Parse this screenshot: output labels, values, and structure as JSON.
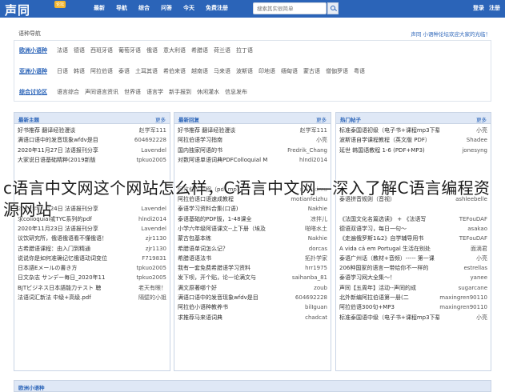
{
  "header": {
    "logo": "声同",
    "logo_badge": "论坛",
    "nav": [
      "最新",
      "导航",
      "综合",
      "问答",
      "今天",
      "免费注册"
    ],
    "search_placeholder": "搜索其实很简单",
    "login": "登录",
    "register": "注册"
  },
  "breadcrumb": "语种导航",
  "welcome": "声同 小语种论坛欢迎大家的光临！",
  "categories": [
    {
      "head": "欧洲小语种",
      "items": [
        "法语",
        "德语",
        "西班牙语",
        "葡萄牙语",
        "俄语",
        "意大利语",
        "希腊语",
        "荷兰语",
        "拉丁语"
      ]
    },
    {
      "head": "亚洲小语种",
      "items": [
        "日语",
        "韩语",
        "阿拉伯语",
        "泰语",
        "土耳其语",
        "希伯来语",
        "越南语",
        "马来语",
        "波斯语",
        "印地语",
        "缅甸语",
        "蒙古语",
        "僧伽罗语",
        "粤语"
      ]
    },
    {
      "head": "综合讨论区",
      "items": [
        "语言综合",
        "声同语言资讯",
        "世界语",
        "语言学",
        "新手报到",
        "休闲灌水",
        "信息发布"
      ]
    }
  ],
  "panels": [
    {
      "title": "最新主题",
      "more": "更多",
      "rows": [
        {
          "title": "好书推荐 翻译经验漫谈",
          "user": "赵学军111"
        },
        {
          "title": "满语口语中的发音现象wfdv是目",
          "user": "604692228"
        },
        {
          "title": "2020年11月27日 法语报刊分享",
          "user": "Lavendel"
        },
        {
          "title": "大家说日语基础精粹(2019新版",
          "user": "tpkuo2005"
        },
        {
          "title": "",
          "user": ""
        },
        {
          "title": "",
          "user": ""
        },
        {
          "title": "",
          "user": ""
        },
        {
          "title": "",
          "user": ""
        },
        {
          "title": "2020年11月24日 法语报刊分享",
          "user": "Lavendel"
        },
        {
          "title": "求colloquial或TYC系列的pdf",
          "user": "hlndi2014"
        },
        {
          "title": "2020年11月23日 法语报刊分享",
          "user": "Lavendel"
        },
        {
          "title": "议饮研究所，俄语俄语看不懂俄语！",
          "user": "zjr1130"
        },
        {
          "title": "古希腊语课程：由入门到精通",
          "user": "zjr1130"
        },
        {
          "title": "说说你是如何准确记忆俄语动词变位",
          "user": "F719831"
        },
        {
          "title": "日本語Eメールの書き方",
          "user": "tpkuo2005"
        },
        {
          "title": "日文杂志 サンデー毎日_2020年11",
          "user": "tpkuo2005"
        },
        {
          "title": "BJTビジネス日本語能力テスト 聴",
          "user": "老天有眼！"
        },
        {
          "title": "法语词汇新法 中级+高级.pdf",
          "user": "隔壁的小姐"
        }
      ]
    },
    {
      "title": "最新回复",
      "more": "更多",
      "rows": [
        {
          "title": "好书推荐 翻译经验漫谈",
          "user": "赵学军111"
        },
        {
          "title": "阿拉伯语学习指南",
          "user": "小亮"
        },
        {
          "title": "国内独家阿语的书",
          "user": "Fredrik_Chang"
        },
        {
          "title": "对数阿语单语词典PDFColloquial M",
          "user": "hlndi2014"
        },
        {
          "title": "",
          "user": ""
        },
        {
          "title": "",
          "user": ""
        },
        {
          "title": "阿拉伯语教程（pdf,mp3）",
          "user": "majokimu"
        },
        {
          "title": "阿拉伯语口语速成教程",
          "user": "motianfeizhu"
        },
        {
          "title": "泰语学习资料合集(口语)",
          "user": "Nakhie"
        },
        {
          "title": "泰语基础的PDF版，1-48课全",
          "user": "凉拌儿"
        },
        {
          "title": "小学六年级阿语课文--上下册（埃及",
          "user": "啪嗒水土"
        },
        {
          "title": "蒙古包基本练",
          "user": "Nakhie"
        },
        {
          "title": "希腊语单词怎么记？",
          "user": "dorcas"
        },
        {
          "title": "希腊语语法书",
          "user": "拓扑学家"
        },
        {
          "title": "我有一套免费希腊语学习资料",
          "user": "hrr1975"
        },
        {
          "title": "发下呗，开个贴，论一论满文与",
          "user": "saihanba_81"
        },
        {
          "title": "满文原著哪个好",
          "user": "zoub"
        },
        {
          "title": "满语口语中的发音现象wfdv是目",
          "user": "604692228"
        },
        {
          "title": "阿拉伯小语种教养书",
          "user": "bilIguan"
        },
        {
          "title": "求推荐马来语词典",
          "user": "chadcat"
        }
      ]
    },
    {
      "title": "热门帖子",
      "more": "更多",
      "rows": [
        {
          "title": "标准泰国语初级（电子书+课程mp3下载）",
          "user": "小亮"
        },
        {
          "title": "波斯语自学课程教程（英文版 PDF）",
          "user": "Shadee"
        },
        {
          "title": "延世 韩国语教程 1-6 (PDF+MP3)",
          "user": "jonesyng"
        },
        {
          "title": "",
          "user": ""
        },
        {
          "title": "",
          "user": ""
        },
        {
          "title": "",
          "user": ""
        },
        {
          "title": "",
          "user": ""
        },
        {
          "title": "泰语拼音规则（音视）",
          "user": "ashleebelle"
        },
        {
          "title": "",
          "user": ""
        },
        {
          "title": "《法国文化名篇选读》 + 《法语写",
          "user": "TEFouDAF"
        },
        {
          "title": "德语双语学习，每日一句～",
          "user": "asakao"
        },
        {
          "title": "《走遍俄罗斯1&2》自学辅导用书",
          "user": "TEFouDAF"
        },
        {
          "title": "A vida cá em Portugal 生活在别处",
          "user": "面滴君"
        },
        {
          "title": "泰语广州话（教材+音频）----- 第一课",
          "user": "小亮"
        },
        {
          "title": "206种国家的语言一带给你不一样的",
          "user": "estrellas"
        },
        {
          "title": "泰语学习网大全集～！",
          "user": "yanee"
        },
        {
          "title": "声同【五周年】活动--声同的成",
          "user": "sugarcane"
        },
        {
          "title": "北外新编阿拉伯语第一册(二",
          "user": "maxingren90110"
        },
        {
          "title": "阿拉伯语300句+MP3",
          "user": "maxingren90110"
        },
        {
          "title": "标准泰国语中级（电子书+课程mp3下载）",
          "user": "小亮"
        }
      ]
    }
  ],
  "bottom_title": "欧洲小语种",
  "overlay_caption": "c语言中文网这个网站怎么样，C语言中文网—深入了解C语言编程资源网站"
}
